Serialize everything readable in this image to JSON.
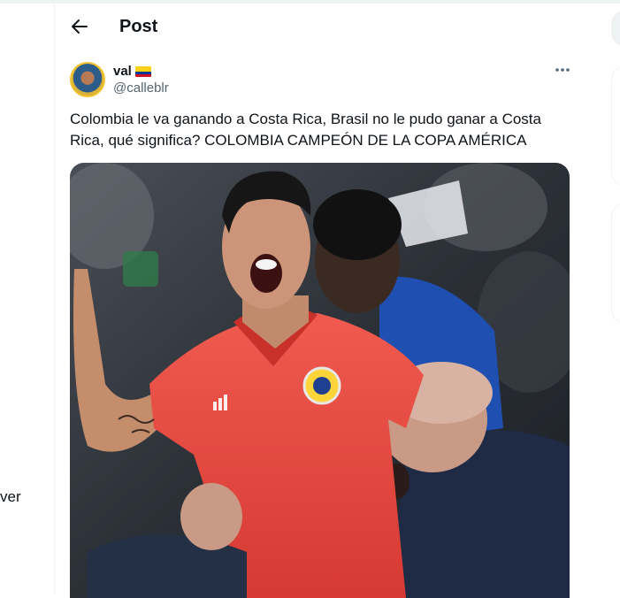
{
  "left": {
    "snippet": "ver"
  },
  "header": {
    "title": "Post",
    "back_icon": "arrow-left-icon"
  },
  "tweet": {
    "display_name": "val",
    "name_emoji": "colombia-flag-icon",
    "handle": "@calleblr",
    "more_icon": "more-horizontal-icon",
    "text": "Colombia le va ganando a Costa Rica, Brasil no le pudo ganar a Costa Rica, qué significa? COLOMBIA CAMPEÓN DE LA COPA AMÉRICA",
    "media_description": "Photo of a celebrating football player in a red Colombia shirt"
  },
  "colors": {
    "text_primary": "#0f1419",
    "text_secondary": "#536471",
    "border": "#eff3f4",
    "shirt_red": "#e8473f"
  }
}
